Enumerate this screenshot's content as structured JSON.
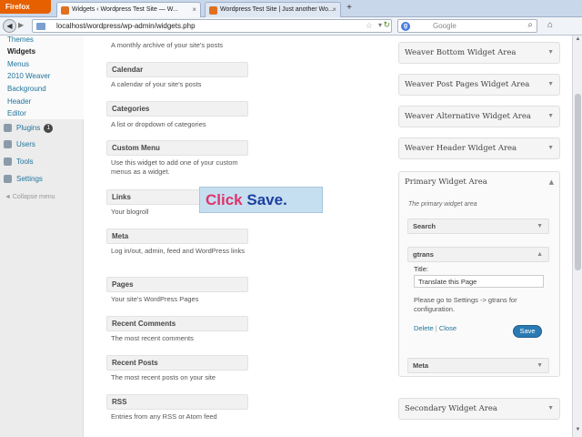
{
  "browser": {
    "app_button": "Firefox",
    "tabs": [
      {
        "title": "Widgets ‹ Wordpress Test Site — W..."
      },
      {
        "title": "Wordpress Test Site | Just another Wo..."
      }
    ],
    "new_tab": "+",
    "url": "localhost/wordpress/wp-admin/widgets.php",
    "search_engine": "Google",
    "search_placeholder": "Google"
  },
  "sidebar": {
    "submenu": [
      {
        "label": "Themes"
      },
      {
        "label": "Widgets"
      },
      {
        "label": "Menus"
      },
      {
        "label": "2010 Weaver"
      },
      {
        "label": "Background"
      },
      {
        "label": "Header"
      },
      {
        "label": "Editor"
      }
    ],
    "menu": [
      {
        "label": "Plugins",
        "badge": "1"
      },
      {
        "label": "Users"
      },
      {
        "label": "Tools"
      },
      {
        "label": "Settings"
      }
    ],
    "collapse": "Collapse menu"
  },
  "available_widgets": [
    {
      "title": "",
      "desc": "A monthly archive of your site's posts"
    },
    {
      "title": "Calendar",
      "desc": "A calendar of your site's posts"
    },
    {
      "title": "Categories",
      "desc": "A list or dropdown of categories"
    },
    {
      "title": "Custom Menu",
      "desc": "Use this widget to add one of your custom menus as a widget."
    },
    {
      "title": "Links",
      "desc": "Your blogroll"
    },
    {
      "title": "Meta",
      "desc": "Log in/out, admin, feed and WordPress links"
    },
    {
      "title": "Pages",
      "desc": "Your site's WordPress Pages"
    },
    {
      "title": "Recent Comments",
      "desc": "The most recent comments"
    },
    {
      "title": "Recent Posts",
      "desc": "The most recent posts on your site"
    },
    {
      "title": "RSS",
      "desc": "Entries from any RSS or Atom feed"
    }
  ],
  "overlay": {
    "word1": "Click",
    "word2": "Save."
  },
  "widget_areas": [
    {
      "title": "Weaver Bottom Widget Area"
    },
    {
      "title": "Weaver Post Pages Widget Area"
    },
    {
      "title": "Weaver Alternative Widget Area"
    },
    {
      "title": "Weaver Header Widget Area"
    }
  ],
  "primary": {
    "title": "Primary Widget Area",
    "desc": "The primary widget area",
    "widgets": [
      {
        "title": "Search"
      },
      {
        "title": "gtrans"
      },
      {
        "title": "Meta"
      }
    ],
    "gtrans_form": {
      "title_label": "Title:",
      "title_value": "Translate this Page",
      "note": "Please go to Settings -> gtrans for configuration.",
      "delete": "Delete",
      "separator": "|",
      "close": "Close",
      "save": "Save"
    }
  },
  "secondary": {
    "title": "Secondary Widget Area"
  },
  "colors": {
    "accent": "#21759b",
    "firefox": "#e66000",
    "save": "#2a7bb3"
  }
}
